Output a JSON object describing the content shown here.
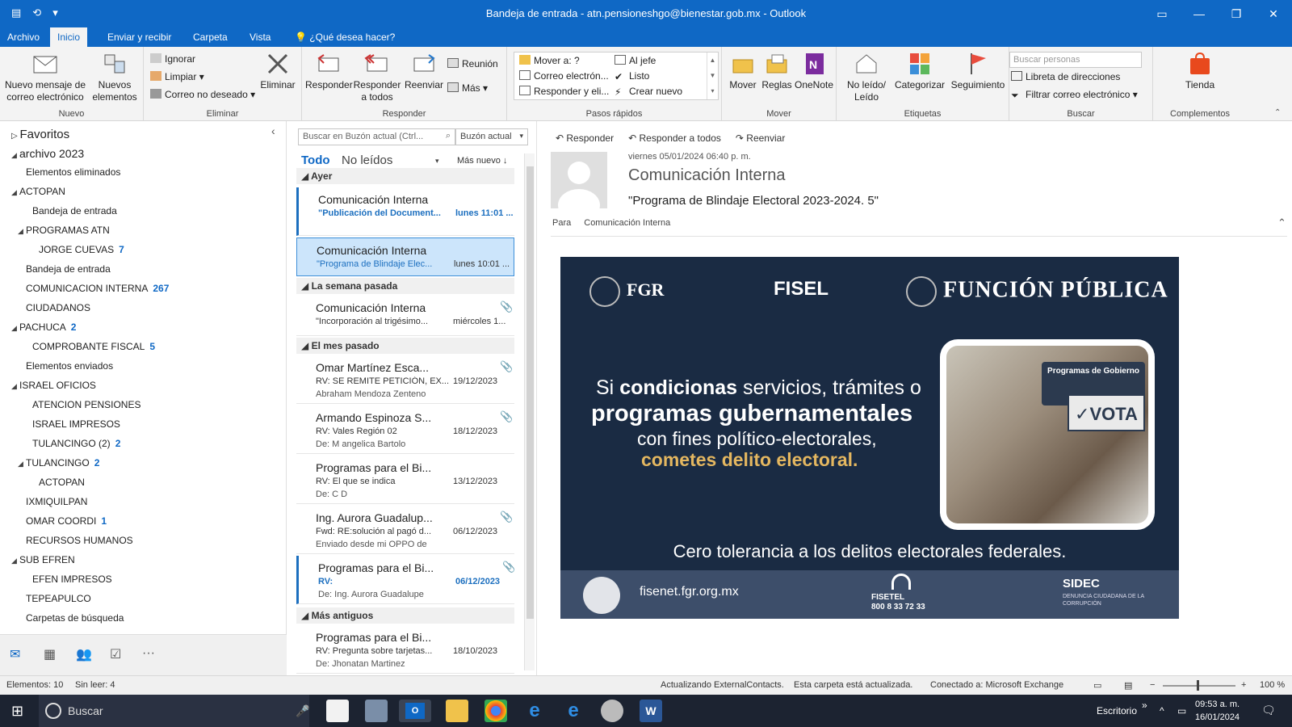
{
  "window": {
    "title": "Bandeja de entrada - atn.pensioneshgo@bienestar.gob.mx - Outlook"
  },
  "tabs": [
    {
      "label": "Archivo"
    },
    {
      "label": "Inicio"
    },
    {
      "label": "Enviar y recibir"
    },
    {
      "label": "Carpeta"
    },
    {
      "label": "Vista"
    },
    {
      "label": "¿Qué desea hacer?"
    }
  ],
  "ribbon": {
    "nuevo": {
      "label": "Nuevo",
      "nuevo_mensaje": "Nuevo mensaje de correo electrónico",
      "nuevos_elementos": "Nuevos elementos"
    },
    "eliminar": {
      "label": "Eliminar",
      "ignorar": "Ignorar",
      "limpiar": "Limpiar",
      "correo_no_deseado": "Correo no deseado",
      "eliminar": "Eliminar"
    },
    "responder": {
      "label": "Responder",
      "responder": "Responder",
      "responder_todos": "Responder a todos",
      "reenviar": "Reenviar",
      "reunion": "Reunión",
      "mas": "Más"
    },
    "pasos_rapidos": {
      "label": "Pasos rápidos",
      "items": [
        "Mover a: ?",
        "Al jefe",
        "Correo electrón...",
        "Listo",
        "Responder y eli...",
        "Crear nuevo"
      ]
    },
    "mover": {
      "label": "Mover",
      "mover": "Mover",
      "reglas": "Reglas",
      "onenote": "OneNote"
    },
    "etiquetas": {
      "label": "Etiquetas",
      "no_leido": "No leído/ Leído",
      "categorizar": "Categorizar",
      "seguimiento": "Seguimiento"
    },
    "buscar": {
      "label": "Buscar",
      "buscar_personas_placeholder": "Buscar personas",
      "libreta": "Libreta de direcciones",
      "filtrar": "Filtrar correo electrónico"
    },
    "complementos": {
      "label": "Complementos",
      "tienda": "Tienda"
    }
  },
  "folders": {
    "favoritos": "Favoritos",
    "items": [
      {
        "label": "archivo 2023",
        "count": "",
        "caret": "◢"
      },
      {
        "label": "Elementos eliminados",
        "count": "",
        "caret": ""
      },
      {
        "label": "ACTOPAN",
        "count": "",
        "caret": "◢"
      },
      {
        "label": "Bandeja de entrada",
        "count": "",
        "caret": ""
      },
      {
        "label": "PROGRAMAS ATN",
        "count": "",
        "caret": "◢"
      },
      {
        "label": "JORGE CUEVAS",
        "count": "7",
        "caret": ""
      },
      {
        "label": "Bandeja de entrada",
        "count": "",
        "caret": ""
      },
      {
        "label": "COMUNICACION INTERNA",
        "count": "267",
        "caret": ""
      },
      {
        "label": "CIUDADANOS",
        "count": "",
        "caret": ""
      },
      {
        "label": "PACHUCA",
        "count": "2",
        "caret": "◢"
      },
      {
        "label": "COMPROBANTE FISCAL",
        "count": "5",
        "caret": ""
      },
      {
        "label": "Elementos enviados",
        "count": "",
        "caret": ""
      },
      {
        "label": "ISRAEL OFICIOS",
        "count": "",
        "caret": "◢"
      },
      {
        "label": "ATENCION PENSIONES",
        "count": "",
        "caret": ""
      },
      {
        "label": "ISRAEL IMPRESOS",
        "count": "",
        "caret": ""
      },
      {
        "label": "TULANCINGO (2)",
        "count": "2",
        "caret": ""
      },
      {
        "label": "TULANCINGO",
        "count": "2",
        "caret": "◢"
      },
      {
        "label": "ACTOPAN",
        "count": "",
        "caret": ""
      },
      {
        "label": "IXMIQUILPAN",
        "count": "",
        "caret": ""
      },
      {
        "label": "OMAR COORDI",
        "count": "1",
        "caret": ""
      },
      {
        "label": "RECURSOS HUMANOS",
        "count": "",
        "caret": ""
      },
      {
        "label": "SUB EFREN",
        "count": "",
        "caret": "◢"
      },
      {
        "label": "EFEN IMPRESOS",
        "count": "",
        "caret": ""
      },
      {
        "label": "TEPEAPULCO",
        "count": "",
        "caret": ""
      },
      {
        "label": "Carpetas de búsqueda",
        "count": "",
        "caret": ""
      }
    ]
  },
  "message_list": {
    "search_placeholder": "Buscar en Buzón actual (Ctrl...",
    "scope": "Buzón actual",
    "filter_all": "Todo",
    "filter_unread": "No leídos",
    "sort": "Más nuevo",
    "groups": {
      "ayer": "Ayer",
      "semana": "La semana pasada",
      "mes": "El mes pasado",
      "antiguos": "Más antiguos"
    },
    "items": [
      {
        "from": "Comunicación Interna",
        "subject": "\"Publicación del Document...",
        "date": "lunes 11:01 ...",
        "preview": ""
      },
      {
        "from": "Comunicación Interna",
        "subject": "\"Programa de Blindaje Elec...",
        "date": "lunes 10:01 ...",
        "preview": ""
      },
      {
        "from": "Comunicación Interna",
        "subject": "\"Incorporación al trigésimo...",
        "date": "miércoles 1...",
        "preview": ""
      },
      {
        "from": "Omar Martínez Esca...",
        "subject": "RV: SE REMITE PETICIÓN, EX...",
        "date": "19/12/2023",
        "preview": "Abraham Mendoza Zenteno"
      },
      {
        "from": "Armando Espinoza S...",
        "subject": "RV: Vales Región 02",
        "date": "18/12/2023",
        "preview": "De: M angelica Bartolo"
      },
      {
        "from": "Programas para el Bi...",
        "subject": "RV: El que se indica",
        "date": "13/12/2023",
        "preview": "De: C D"
      },
      {
        "from": "Ing. Aurora Guadalup...",
        "subject": "Fwd: RE:solución al pagó d...",
        "date": "06/12/2023",
        "preview": "Enviado desde mi OPPO de"
      },
      {
        "from": "Programas para el Bi...",
        "subject": "RV:",
        "date": "06/12/2023",
        "preview": "De: Ing. Aurora Guadalupe"
      },
      {
        "from": "Programas para el Bi...",
        "subject": "RV: Pregunta sobre tarjetas...",
        "date": "18/10/2023",
        "preview": "De: Jhonatan Martinez"
      }
    ]
  },
  "reading": {
    "actions": [
      "Responder",
      "Responder a todos",
      "Reenviar"
    ],
    "date": "viernes 05/01/2024 06:40 p. m.",
    "from": "Comunicación Interna",
    "subject": "\"Programa de Blindaje Electoral 2023-2024. 5\"",
    "to_label": "Para",
    "to": "Comunicación Interna",
    "banner": {
      "fgr": "FGR",
      "fisel": "FISEL",
      "funcion_publica": "FUNCIÓN PÚBLICA",
      "line1_pre": "Si",
      "line1_bold": "condicionas",
      "line1_post": "servicios, trámites o",
      "line2": "programas gubernamentales",
      "line3": "con fines político-electorales,",
      "line4": "cometes delito electoral.",
      "sign": "Programas de Gobierno",
      "vota": "VOTA",
      "tagline": "Cero tolerancia a los delitos electorales federales.",
      "url": "fisenet.fgr.org.mx",
      "fisetel": "FISETEL",
      "fisetel_num": "800 8 33 72 33",
      "sidec": "SIDEC",
      "sidec_sub": "DENUNCIA CIUDADANA DE LA CORRUPCIÓN"
    }
  },
  "statusbar": {
    "elementos": "Elementos: 10",
    "sin_leer": "Sin leer: 4",
    "actualizando": "Actualizando ExternalContacts.",
    "carpeta": "Esta carpeta está actualizada.",
    "conectado": "Conectado a: Microsoft Exchange",
    "zoom": "100 %"
  },
  "taskbar": {
    "search": "Buscar",
    "escritorio": "Escritorio",
    "time": "09:53 a. m.",
    "date": "16/01/2024"
  },
  "colors": {
    "accent": "#0f68c5",
    "unread": "#1c6fbf",
    "banner_bg": "#1a2b43",
    "banner_gold": "#e4b760"
  }
}
